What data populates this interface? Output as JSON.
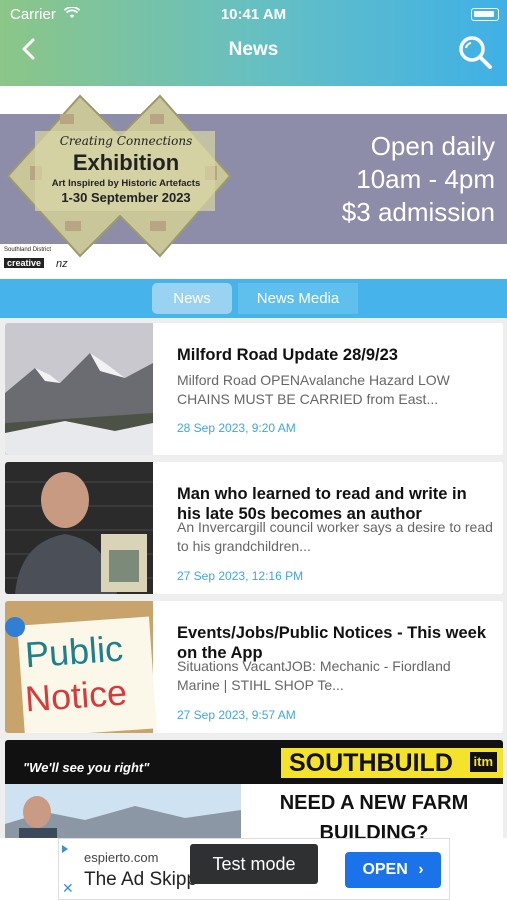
{
  "status_bar": {
    "carrier": "Carrier",
    "time": "10:41 AM"
  },
  "nav": {
    "title": "News"
  },
  "banner": {
    "line1": "Creating Connections",
    "line2": "Exhibition",
    "line3": "Art Inspired by Historic Artefacts",
    "line4": "1-30 September 2023",
    "info": [
      "Open daily",
      "10am - 4pm",
      "$3 admission"
    ],
    "district": "Southland District",
    "creative": "creative",
    "creative_nz": "nz"
  },
  "tabs": [
    {
      "label": "News",
      "selected": true
    },
    {
      "label": "News Media",
      "selected": false
    }
  ],
  "news": [
    {
      "title": "Milford Road Update 28/9/23",
      "summary": "Milford Road OPENAvalanche Hazard LOW  CHAINS MUST BE CARRIED from East...",
      "date": "28 Sep 2023, 9:20 AM"
    },
    {
      "title": "Man who learned to read and write in his late 50s becomes an author",
      "summary": "An Invercargill council worker says a desire to read to his grandchildren...",
      "date": "27 Sep 2023, 12:16 PM"
    },
    {
      "title": "Events/Jobs/Public Notices - This week on the App",
      "summary": "Situations VacantJOB: Mechanic - Fiordland Marine | STIHL SHOP Te...",
      "date": "27 Sep 2023, 9:57 AM"
    }
  ],
  "public_notice": {
    "line1": "Public",
    "line2": "Notice"
  },
  "southbuild_ad": {
    "tagline": "\"We'll see you right\"",
    "brand": "SOUTHBUILD",
    "brand_badge": "itm",
    "headline_1": "NEED A NEW FARM",
    "headline_2": "BUILDING?"
  },
  "bottom_ad": {
    "domain": "espierto.com",
    "name": "The Ad Skipp",
    "test_mode": "Test mode",
    "open_label": "OPEN"
  }
}
